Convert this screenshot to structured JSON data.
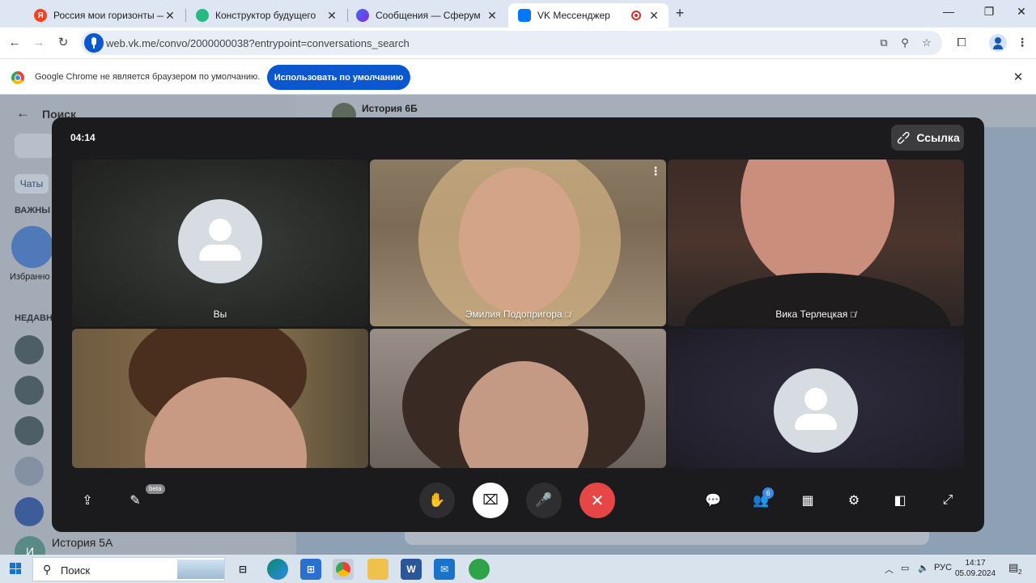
{
  "browser": {
    "tabs": [
      {
        "title": "Россия мои горизонты — Янд",
        "favicon": "yandex-icon",
        "color": "#fc3f1d"
      },
      {
        "title": "Конструктор будущего",
        "favicon": "konstruktor-icon",
        "color": "#28b983"
      },
      {
        "title": "Сообщения — Сферум",
        "favicon": "sferum-icon",
        "color": "#5b3cc4"
      },
      {
        "title": "VK Мессенджер",
        "favicon": "vk-icon",
        "color": "#0077ff",
        "active": true,
        "recording": true
      }
    ],
    "new_tab": "+",
    "url": "web.vk.me/convo/2000000038?entrypoint=conversations_search",
    "infobar": {
      "message": "Google Chrome не является браузером по умолчанию.",
      "button": "Использовать по умолчанию"
    }
  },
  "vk": {
    "search_title": "Поиск",
    "chats_tab": "Чаты",
    "important_label": "ВАЖНЫ",
    "favorites_label": "Избранно",
    "recent_label": "НЕДАВН",
    "chat_name": "История 6Б",
    "bottom_chat": "История 5А",
    "bottom_avatar_letter": "И"
  },
  "call": {
    "timer": "04:14",
    "link_button": "Ссылка",
    "participants": [
      {
        "name": "Вы",
        "video": false,
        "muted": false
      },
      {
        "name": "Эмилия Подопригора",
        "video": true,
        "muted": true
      },
      {
        "name": "Вика Терлецкая",
        "video": true,
        "muted": true
      },
      {
        "name": "",
        "video": true,
        "muted": false
      },
      {
        "name": "",
        "video": true,
        "muted": false
      },
      {
        "name": "",
        "video": false,
        "muted": false
      }
    ],
    "controls": {
      "beta_label": "beta",
      "participants_count": "6"
    },
    "colors": {
      "end_call": "#e64646",
      "window": "#1b1b1d"
    }
  },
  "taskbar": {
    "search_placeholder": "Поиск",
    "language": "РУС",
    "time": "14:17",
    "date": "05.09.2024",
    "notification_count": "2"
  }
}
